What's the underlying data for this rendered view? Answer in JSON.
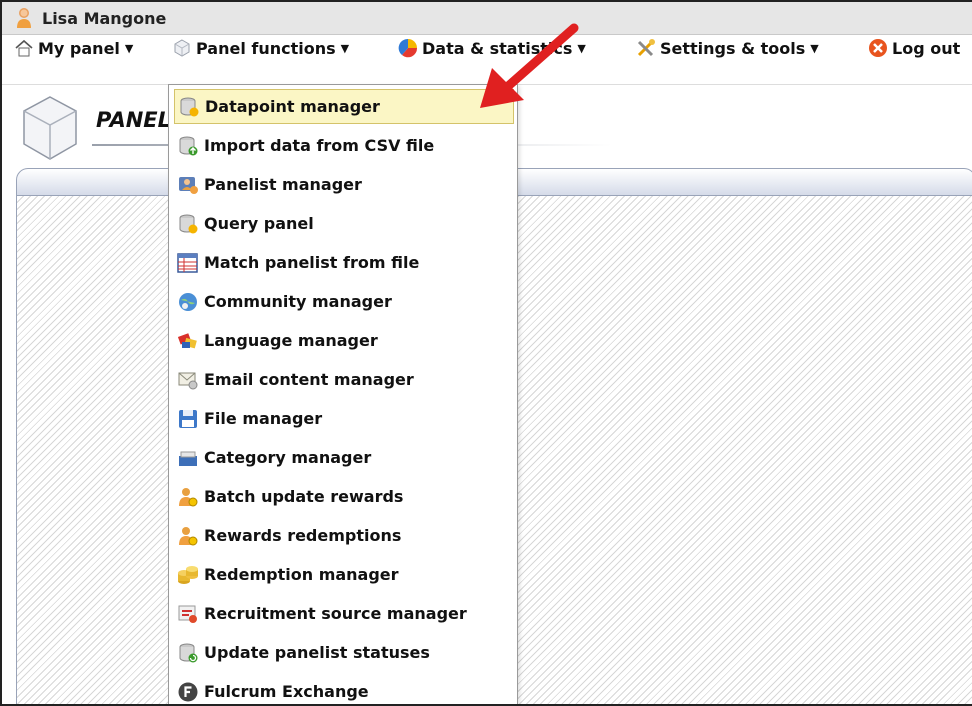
{
  "titlebar": {
    "user_name": "Lisa Mangone"
  },
  "menubar": {
    "items": [
      {
        "label": "My panel",
        "icon": "home-icon"
      },
      {
        "label": "Panel functions",
        "icon": "cube-icon"
      },
      {
        "label": "Data & statistics",
        "icon": "chart-icon"
      },
      {
        "label": "Settings & tools",
        "icon": "tools-icon"
      },
      {
        "label": "Log out",
        "icon": "logout-icon"
      }
    ]
  },
  "page": {
    "title": "PANEL"
  },
  "dropdown": {
    "items": [
      {
        "label": "Datapoint manager",
        "icon": "database-icon",
        "active": true
      },
      {
        "label": "Import data from CSV file",
        "icon": "database-import-icon"
      },
      {
        "label": "Panelist manager",
        "icon": "panelist-icon"
      },
      {
        "label": "Query panel",
        "icon": "database-query-icon"
      },
      {
        "label": "Match panelist from file",
        "icon": "table-icon"
      },
      {
        "label": "Community manager",
        "icon": "community-icon"
      },
      {
        "label": "Language manager",
        "icon": "language-icon"
      },
      {
        "label": "Email content manager",
        "icon": "email-icon"
      },
      {
        "label": "File manager",
        "icon": "floppy-icon"
      },
      {
        "label": "Category manager",
        "icon": "category-icon"
      },
      {
        "label": "Batch update rewards",
        "icon": "person-reward-icon"
      },
      {
        "label": "Rewards redemptions",
        "icon": "person-reward-icon"
      },
      {
        "label": "Redemption manager",
        "icon": "coins-icon"
      },
      {
        "label": "Recruitment source manager",
        "icon": "recruitment-icon"
      },
      {
        "label": "Update panelist statuses",
        "icon": "database-refresh-icon"
      },
      {
        "label": "Fulcrum Exchange",
        "icon": "fulcrum-icon"
      }
    ]
  },
  "colors": {
    "highlight_bg": "#fbf6c5",
    "arrow": "#e02020"
  }
}
